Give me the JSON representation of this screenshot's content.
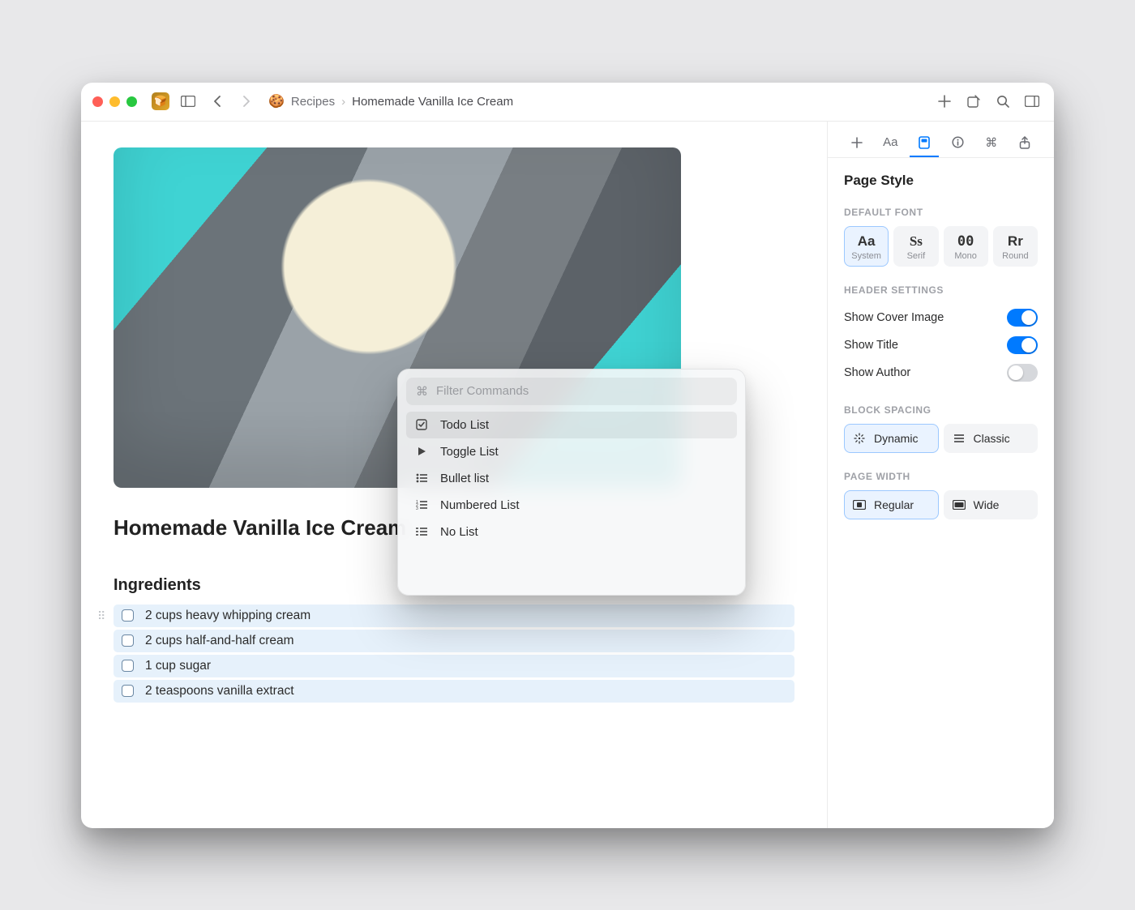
{
  "breadcrumb": {
    "emoji": "🍪",
    "parent": "Recipes",
    "current": "Homemade Vanilla Ice Cream"
  },
  "page": {
    "title": "Homemade Vanilla Ice Cream",
    "section": "Ingredients",
    "ingredients": [
      "2 cups heavy whipping cream",
      "2 cups half-and-half cream",
      "1 cup sugar",
      "2 teaspoons vanilla extract"
    ]
  },
  "palette": {
    "placeholder": "Filter Commands",
    "items": [
      {
        "label": "Todo List"
      },
      {
        "label": "Toggle List"
      },
      {
        "label": "Bullet list"
      },
      {
        "label": "Numbered List"
      },
      {
        "label": "No List"
      }
    ]
  },
  "inspector": {
    "title": "Page Style",
    "section_default_font": "DEFAULT FONT",
    "fonts": {
      "system": {
        "big": "Aa",
        "label": "System"
      },
      "serif": {
        "big": "Ss",
        "label": "Serif"
      },
      "mono": {
        "big": "00",
        "label": "Mono"
      },
      "round": {
        "big": "Rr",
        "label": "Round"
      }
    },
    "section_header": "HEADER SETTINGS",
    "toggles": {
      "cover": {
        "label": "Show Cover Image",
        "on": true
      },
      "title": {
        "label": "Show Title",
        "on": true
      },
      "author": {
        "label": "Show Author",
        "on": false
      }
    },
    "section_block_spacing": "BLOCK SPACING",
    "spacing": {
      "dynamic": "Dynamic",
      "classic": "Classic"
    },
    "section_page_width": "PAGE WIDTH",
    "width": {
      "regular": "Regular",
      "wide": "Wide"
    }
  }
}
